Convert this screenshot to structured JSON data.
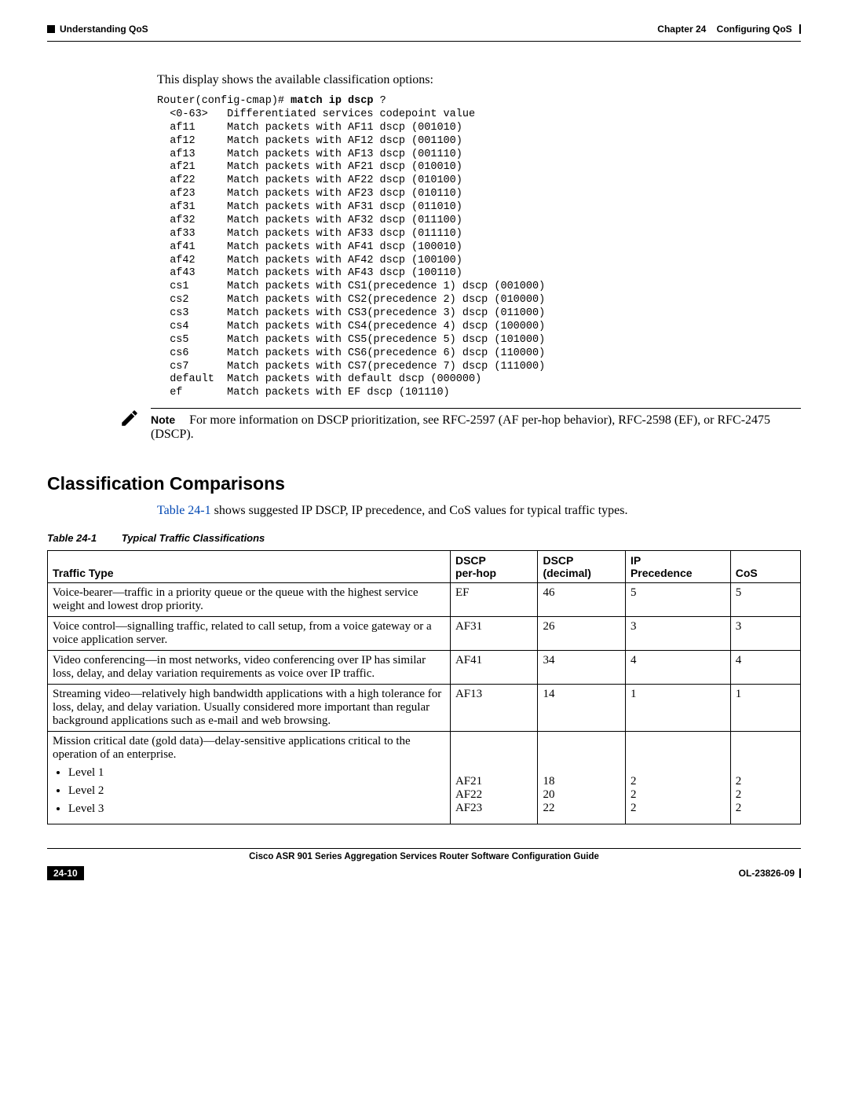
{
  "header": {
    "left": "Understanding QoS",
    "chapter": "Chapter 24",
    "chapter_title": "Configuring QoS"
  },
  "intro": "This display shows the available classification options:",
  "code": {
    "prompt": "Router(config-cmap)# ",
    "command": "match ip dscp ",
    "question": "?",
    "lines": "  <0-63>   Differentiated services codepoint value\n  af11     Match packets with AF11 dscp (001010)\n  af12     Match packets with AF12 dscp (001100)\n  af13     Match packets with AF13 dscp (001110)\n  af21     Match packets with AF21 dscp (010010)\n  af22     Match packets with AF22 dscp (010100)\n  af23     Match packets with AF23 dscp (010110)\n  af31     Match packets with AF31 dscp (011010)\n  af32     Match packets with AF32 dscp (011100)\n  af33     Match packets with AF33 dscp (011110)\n  af41     Match packets with AF41 dscp (100010)\n  af42     Match packets with AF42 dscp (100100)\n  af43     Match packets with AF43 dscp (100110)\n  cs1      Match packets with CS1(precedence 1) dscp (001000)\n  cs2      Match packets with CS2(precedence 2) dscp (010000)\n  cs3      Match packets with CS3(precedence 3) dscp (011000)\n  cs4      Match packets with CS4(precedence 4) dscp (100000)\n  cs5      Match packets with CS5(precedence 5) dscp (101000)\n  cs6      Match packets with CS6(precedence 6) dscp (110000)\n  cs7      Match packets with CS7(precedence 7) dscp (111000)\n  default  Match packets with default dscp (000000)\n  ef       Match packets with EF dscp (101110)"
  },
  "note": {
    "label": "Note",
    "text": "For more information on DSCP prioritization, see RFC-2597 (AF per-hop behavior), RFC-2598 (EF), or RFC-2475 (DSCP)."
  },
  "section": {
    "title": "Classification Comparisons",
    "intro_pre": "",
    "table_ref": "Table 24-1",
    "intro_post": " shows suggested IP DSCP, IP precedence, and CoS values for typical traffic types."
  },
  "table": {
    "caption_num": "Table 24-1",
    "caption_title": "Typical Traffic Classifications",
    "headers": {
      "c0": "Traffic Type",
      "c1a": "DSCP",
      "c1b": "per-hop",
      "c2a": "DSCP",
      "c2b": "(decimal)",
      "c3a": "IP",
      "c3b": "Precedence",
      "c4": "CoS"
    },
    "rows": [
      {
        "type": "Voice-bearer—traffic in a priority queue or the queue with the highest service weight and lowest drop priority.",
        "perhop": "EF",
        "dec": "46",
        "prec": "5",
        "cos": "5"
      },
      {
        "type": "Voice control—signalling traffic, related to call setup, from a voice gateway or a voice application server.",
        "perhop": "AF31",
        "dec": "26",
        "prec": "3",
        "cos": "3"
      },
      {
        "type": "Video conferencing—in most networks, video conferencing over IP has similar loss, delay, and delay variation requirements as voice over IP traffic.",
        "perhop": "AF41",
        "dec": "34",
        "prec": "4",
        "cos": "4"
      },
      {
        "type": "Streaming video—relatively high bandwidth applications with a high tolerance for loss, delay, and delay variation. Usually considered more important than regular background applications such as e-mail and web browsing.",
        "perhop": "AF13",
        "dec": "14",
        "prec": "1",
        "cos": "1"
      }
    ],
    "mission": {
      "intro": "Mission critical date (gold data)—delay-sensitive applications critical to the operation of an enterprise.",
      "levels": [
        "Level 1",
        "Level 2",
        "Level 3"
      ],
      "perhop": "AF21\nAF22\nAF23",
      "dec": "18\n20\n22",
      "prec": "2\n2\n2",
      "cos": "2\n2\n2"
    }
  },
  "footer": {
    "book": "Cisco ASR 901 Series Aggregation Services Router Software Configuration Guide",
    "page": "24-10",
    "docid": "OL-23826-09"
  }
}
